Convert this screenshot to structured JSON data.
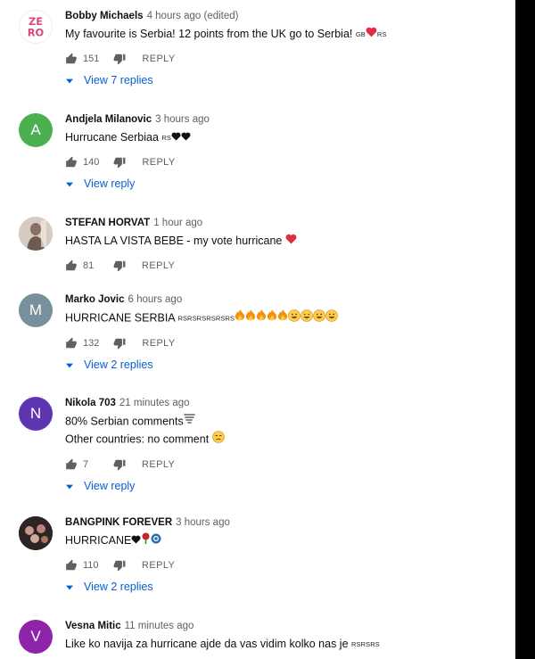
{
  "comments": [
    {
      "author": "Bobby Michaels",
      "time": "4 hours ago (edited)",
      "text": "My favourite is Serbia! 12 points from the UK go to Serbia!",
      "flag_prefix": "GB",
      "flag_suffix": "RS",
      "likes": "151",
      "reply_label": "REPLY",
      "view_replies": "View 7 replies",
      "avatar_text_top": "ZE",
      "avatar_text_bottom": "RO",
      "avatar_color": "#ffffff"
    },
    {
      "author": "Andjela Milanovic",
      "time": "3 hours ago",
      "text": "Hurrucane Serbiaa",
      "flag_suffix": "RS",
      "likes": "140",
      "reply_label": "REPLY",
      "view_replies": "View reply",
      "avatar_initial": "A",
      "avatar_color": "#4caf50"
    },
    {
      "author": "STEFAN HORVAT",
      "time": "1 hour ago",
      "text": "HASTA LA VISTA BEBE - my vote hurricane",
      "likes": "81",
      "reply_label": "REPLY",
      "avatar_color": "#b9a9a0"
    },
    {
      "author": "Marko Jovic",
      "time": "6 hours ago",
      "text": "HURRICANE SERBIA",
      "flag_suffix": "RSRSRSRSRSRS",
      "likes": "132",
      "reply_label": "REPLY",
      "view_replies": "View 2 replies",
      "avatar_initial": "M",
      "avatar_color": "#78909c"
    },
    {
      "author": "Nikola 703",
      "time": "21 minutes ago",
      "text": "80% Serbian comments",
      "text_line2": "Other countries: no comment",
      "likes": "7",
      "reply_label": "REPLY",
      "view_replies": "View reply",
      "avatar_initial": "N",
      "avatar_color": "#5e35b1"
    },
    {
      "author": "BANGPINK FOREVER",
      "time": "3 hours ago",
      "text": "HURRICANE",
      "likes": "110",
      "reply_label": "REPLY",
      "view_replies": "View 2 replies",
      "avatar_color": "#3a2e2e"
    },
    {
      "author": "Vesna Mitic",
      "time": "11 minutes ago",
      "text": "Like ko navija za hurricane ajde da vas vidim kolko nas je",
      "flag_suffix": "RSRSRS",
      "avatar_initial": "V",
      "avatar_color": "#8e24aa"
    }
  ],
  "icons": {
    "like": "thumb-up-icon",
    "dislike": "thumb-down-icon",
    "expand": "chevron-down-icon",
    "heart": "heart-emoji",
    "black_heart": "black-heart-emoji",
    "fire": "fire-emoji",
    "grin": "grin-emoji",
    "smirk": "unamused-emoji",
    "tornado": "tornado-emoji",
    "rose": "rose-emoji",
    "globe": "blue-circle-emoji"
  },
  "colors": {
    "link_blue": "#065fd4",
    "meta_gray": "#606060",
    "heart_red": "#dd2e44"
  }
}
